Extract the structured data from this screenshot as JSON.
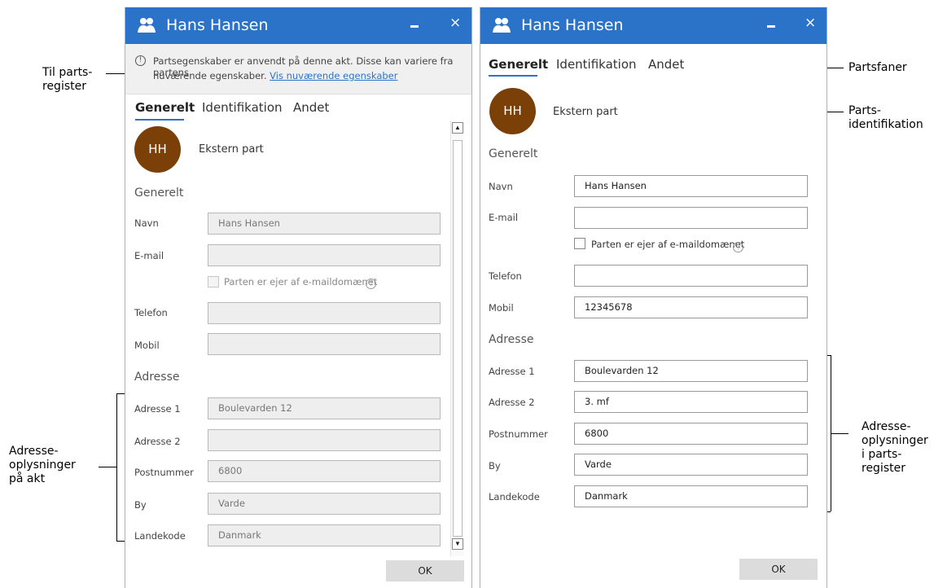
{
  "annotations": {
    "til_parts_register": [
      "Til parts-",
      "register"
    ],
    "adresse_paa_akt": [
      "Adresse-",
      "oplysninger",
      "på akt"
    ],
    "partsfaner": "Partsfaner",
    "parts_identifikation": [
      "Parts-",
      "identifikation"
    ],
    "adresse_i_register": [
      "Adresse-",
      "oplysninger",
      "i parts-",
      "register"
    ]
  },
  "left_dialog": {
    "title": "Hans Hansen",
    "close_glyph": "×",
    "info": {
      "icon": "!",
      "line1": "Partsegenskaber er anvendt på denne akt. Disse kan variere fra partens",
      "line2": "nuværende egenskaber.",
      "link": "Vis nuværende egenskaber"
    },
    "tabs": [
      "Generelt",
      "Identifikation",
      "Andet"
    ],
    "avatar": "HH",
    "party_type": "Ekstern part",
    "section_general": "Generelt",
    "labels": {
      "navn": "Navn",
      "email": "E-mail",
      "telefon": "Telefon",
      "mobil": "Mobil",
      "adresse1": "Adresse 1",
      "adresse2": "Adresse 2",
      "postnummer": "Postnummer",
      "by": "By",
      "landekode": "Landekode"
    },
    "values": {
      "navn": "Hans Hansen",
      "email": "",
      "telefon": "",
      "mobil": "",
      "adresse1": "Boulevarden 12",
      "adresse2": "",
      "postnummer": "6800",
      "by": "Varde",
      "landekode": "Danmark"
    },
    "checkbox_label": "Parten er ejer af e-maildomænet",
    "help": "?",
    "section_address": "Adresse",
    "ok": "OK",
    "scroll_up": "▲",
    "scroll_down": "▼"
  },
  "right_dialog": {
    "title": "Hans Hansen",
    "close_glyph": "×",
    "tabs": [
      "Generelt",
      "Identifikation",
      "Andet"
    ],
    "avatar": "HH",
    "party_type": "Ekstern part",
    "section_general": "Generelt",
    "labels": {
      "navn": "Navn",
      "email": "E-mail",
      "telefon": "Telefon",
      "mobil": "Mobil",
      "adresse1": "Adresse 1",
      "adresse2": "Adresse 2",
      "postnummer": "Postnummer",
      "by": "By",
      "landekode": "Landekode"
    },
    "values": {
      "navn": "Hans Hansen",
      "email": "",
      "telefon": "",
      "mobil": "12345678",
      "adresse1": "Boulevarden 12",
      "adresse2": "3. mf",
      "postnummer": "6800",
      "by": "Varde",
      "landekode": "Danmark"
    },
    "checkbox_label": "Parten er ejer af e-maildomænet",
    "help": "?",
    "section_address": "Adresse",
    "ok": "OK"
  },
  "colors": {
    "titlebar": "#2b73c9",
    "avatar": "#7b4008",
    "accent": "#2b73c9"
  }
}
